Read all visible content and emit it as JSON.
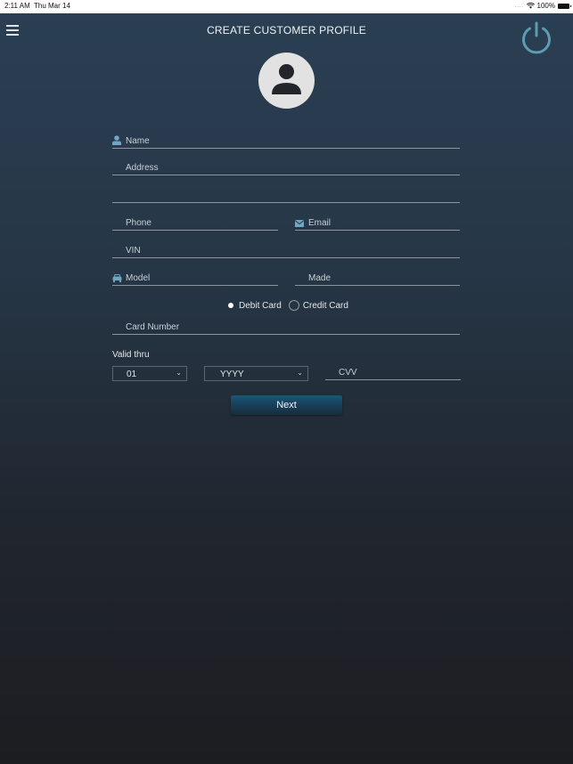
{
  "status_bar": {
    "time": "2:11 AM",
    "date": "Thu Mar 14",
    "signal": "....",
    "wifi_icon": "wifi-icon",
    "battery": "100%",
    "battery_icon": "battery-icon"
  },
  "header": {
    "menu_icon": "hamburger-menu-icon",
    "title": "CREATE CUSTOMER PROFILE",
    "power_icon": "power-icon"
  },
  "avatar": {
    "icon": "user-avatar-icon"
  },
  "form": {
    "name": {
      "placeholder": "Name",
      "icon": "person-icon"
    },
    "address": {
      "placeholder": "Address"
    },
    "address_line2": {
      "placeholder": ""
    },
    "phone": {
      "placeholder": "Phone"
    },
    "email": {
      "placeholder": "Email",
      "icon": "envelope-icon"
    },
    "vin": {
      "placeholder": "VIN"
    },
    "model": {
      "placeholder": "Model",
      "icon": "car-icon"
    },
    "made": {
      "placeholder": "Made"
    },
    "payment_type": {
      "options": [
        {
          "label": "Debit Card",
          "selected": true
        },
        {
          "label": "Credit Card",
          "selected": false
        }
      ]
    },
    "card_number": {
      "placeholder": "Card Number"
    },
    "valid_thru": {
      "label": "Valid thru",
      "month": "01",
      "year": "YYYY"
    },
    "cvv": {
      "placeholder": "CVV"
    },
    "next_label": "Next"
  },
  "colors": {
    "accent_icon": "#6fa6c2",
    "power_icon": "#5e9cb3",
    "button": "#1d5673"
  }
}
